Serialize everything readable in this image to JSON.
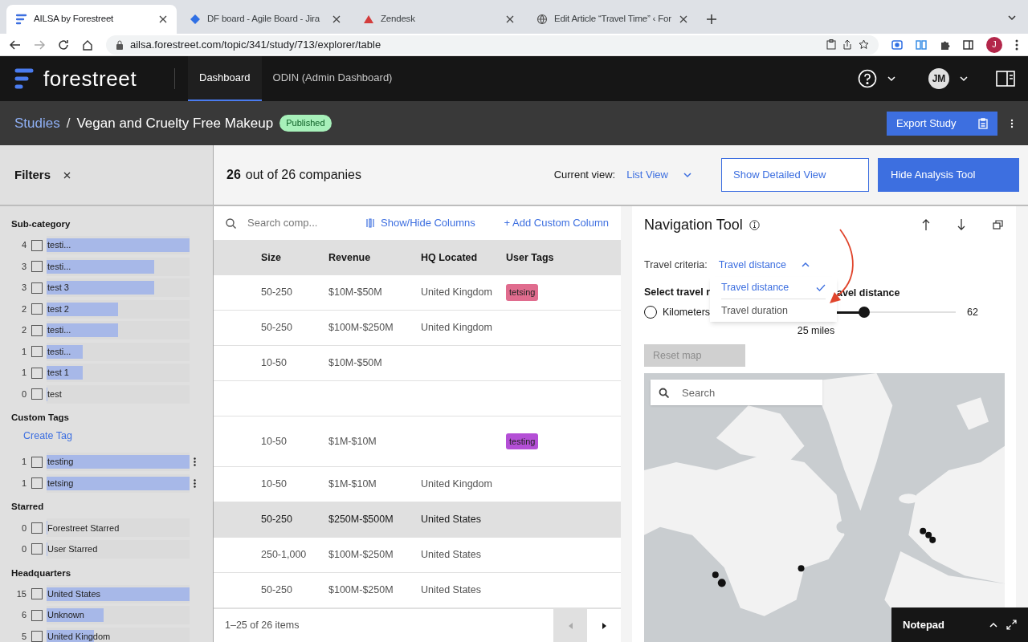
{
  "browser": {
    "tabs": [
      {
        "title": "AILSA by Forestreet",
        "selected": true
      },
      {
        "title": "DF board - Agile Board - Jira",
        "selected": false
      },
      {
        "title": "Zendesk",
        "selected": false
      },
      {
        "title": "Edit Article “Travel Time” ‹ For",
        "selected": false
      }
    ],
    "url": "ailsa.forestreet.com/topic/341/study/713/explorer/table",
    "profile": "J"
  },
  "app": {
    "logo": "forestreet",
    "nav": [
      {
        "label": "Dashboard",
        "selected": true
      },
      {
        "label": "ODIN (Admin Dashboard)",
        "selected": false
      }
    ],
    "user": "JM"
  },
  "study": {
    "breadcrumb": "Studies",
    "separator": "/",
    "title": "Vegan and Cruelty Free Makeup",
    "status": "Published",
    "export": "Export Study"
  },
  "filters": {
    "title": "Filters",
    "groups": [
      {
        "title": "Sub-category",
        "items": [
          {
            "count": "4",
            "label": "testi...",
            "checked": false,
            "level": 1,
            "menu": false
          },
          {
            "count": "3",
            "label": "testi...",
            "checked": false,
            "level": 0.75,
            "menu": false
          },
          {
            "count": "3",
            "label": "test 3",
            "checked": false,
            "level": 0.75,
            "menu": false
          },
          {
            "count": "2",
            "label": "test 2",
            "checked": false,
            "level": 0.5,
            "menu": false
          },
          {
            "count": "2",
            "label": "testi...",
            "checked": false,
            "level": 0.5,
            "menu": false
          },
          {
            "count": "1",
            "label": "testi...",
            "checked": false,
            "level": 0.25,
            "menu": false
          },
          {
            "count": "1",
            "label": "test 1",
            "checked": false,
            "level": 0.25,
            "menu": false
          },
          {
            "count": "0",
            "label": "test",
            "checked": false,
            "level": 0,
            "menu": false
          }
        ]
      },
      {
        "title": "Custom Tags",
        "link": "Create Tag",
        "items": [
          {
            "count": "1",
            "label": "testing",
            "checked": false,
            "level": 1,
            "menu": true
          },
          {
            "count": "1",
            "label": "tetsing",
            "checked": false,
            "level": 1,
            "menu": true
          }
        ]
      },
      {
        "title": "Starred",
        "items": [
          {
            "count": "0",
            "label": "Forestreet Starred",
            "checked": false,
            "level": 0,
            "menu": false
          },
          {
            "count": "0",
            "label": "User Starred",
            "checked": false,
            "level": 0,
            "menu": false
          }
        ]
      },
      {
        "title": "Headquarters",
        "items": [
          {
            "count": "15",
            "label": "United States",
            "checked": false,
            "level": 1,
            "menu": false
          },
          {
            "count": "6",
            "label": "Unknown",
            "checked": false,
            "level": 0.4,
            "menu": false
          },
          {
            "count": "5",
            "label": "United Kingdom",
            "checked": false,
            "level": 0.33,
            "menu": false
          }
        ]
      }
    ]
  },
  "toolbar": {
    "count": "26",
    "summary": "out of 26 companies",
    "view_label": "Current view:",
    "view": "List View",
    "detailed": "Show Detailed View",
    "hide": "Hide Analysis Tool"
  },
  "table": {
    "search_placeholder": "Search comp...",
    "show_hide": "Show/Hide Columns",
    "add_column": "+ Add Custom Column",
    "columns": [
      "Size",
      "Revenue",
      "HQ Located",
      "User Tags"
    ],
    "rows": [
      {
        "size": "50-250",
        "revenue": "$10M-$50M",
        "hq": "United Kingdom",
        "tag": {
          "label": "tetsing",
          "color": "#e06c8e"
        },
        "selected": false
      },
      {
        "size": "50-250",
        "revenue": "$100M-$250M",
        "hq": "United Kingdom",
        "selected": false
      },
      {
        "size": "10-50",
        "revenue": "$10M-$50M",
        "selected": false
      },
      {
        "selected": false
      },
      {
        "size": "10-50",
        "revenue": "$1M-$10M",
        "tag": {
          "label": "testing",
          "color": "#b44fd6"
        },
        "selected": false
      },
      {
        "size": "10-50",
        "revenue": "$1M-$10M",
        "hq": "United Kingdom",
        "selected": false
      },
      {
        "size": "50-250",
        "revenue": "$250M-$500M",
        "hq": "United States",
        "selected": true
      },
      {
        "size": "250-1,000",
        "revenue": "$100M-$250M",
        "hq": "United States",
        "selected": false
      },
      {
        "size": "50-250",
        "revenue": "$100M-$250M",
        "hq": "United States",
        "selected": false
      }
    ],
    "footer": "1–25 of 26 items"
  },
  "navigation": {
    "title": "Navigation Tool",
    "criteria_label": "Travel criteria:",
    "criteria": "Travel distance",
    "options": [
      {
        "label": "Travel distance",
        "selected": true
      },
      {
        "label": "Travel duration",
        "selected": false
      }
    ],
    "unit_heading": "Select travel r",
    "unit": {
      "label": "Kilometers",
      "selected": false
    },
    "distance_heading": "avel distance",
    "slider": {
      "level": 0.4,
      "max": "62",
      "reading": "25 miles"
    },
    "reset": "Reset map",
    "map_search_placeholder": "Search"
  },
  "notepad": {
    "title": "Notepad"
  }
}
